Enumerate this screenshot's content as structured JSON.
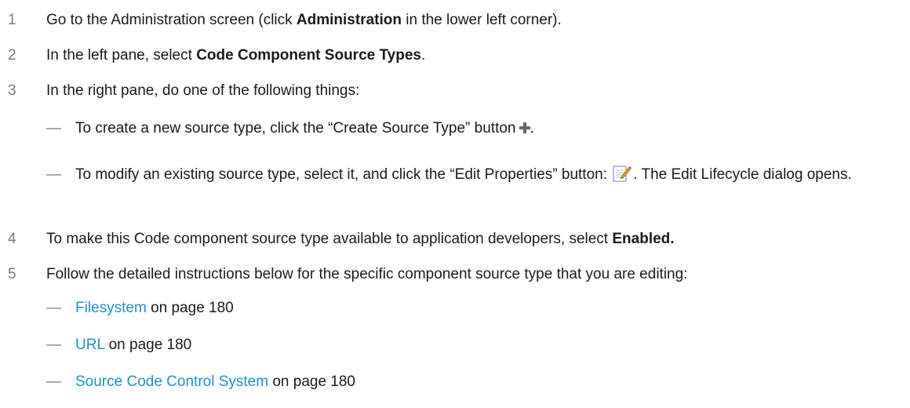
{
  "steps": [
    {
      "num": "1",
      "pre": "Go to the Administration screen (click ",
      "bold": "Administration",
      "post": " in the lower left corner)."
    },
    {
      "num": "2",
      "pre": "In the left pane, select ",
      "bold": "Code Component Source Types",
      "post": "."
    },
    {
      "num": "3",
      "text": "In the right pane, do one of the following things:"
    },
    {
      "num": "4",
      "pre": "To make this Code component source type available to application developers, select ",
      "bold": "Enabled.",
      "post": ""
    },
    {
      "num": "5",
      "text": "Follow the detailed instructions below for the specific component source type that you are editing:"
    }
  ],
  "step3_options": [
    {
      "dash": "—",
      "pre": "To create a new source type, click the “Create Source Type” button",
      "icon": "plus-icon",
      "post": "."
    },
    {
      "dash": "—",
      "pre": "To modify an existing source type, select it, and click the “Edit Properties” button:",
      "icon": "edit-properties-icon",
      "post": ". The Edit Lifecycle dialog opens."
    }
  ],
  "step5_links": [
    {
      "dash": "—",
      "link": "Filesystem",
      "suffix": " on page 180"
    },
    {
      "dash": "—",
      "link": "URL",
      "suffix": " on page 180"
    },
    {
      "dash": "—",
      "link": "Source Code Control System",
      "suffix": " on page 180"
    }
  ],
  "colors": {
    "link": "#1f8fc9",
    "step_number": "#7a7a7a",
    "text": "#1a1a1a"
  }
}
